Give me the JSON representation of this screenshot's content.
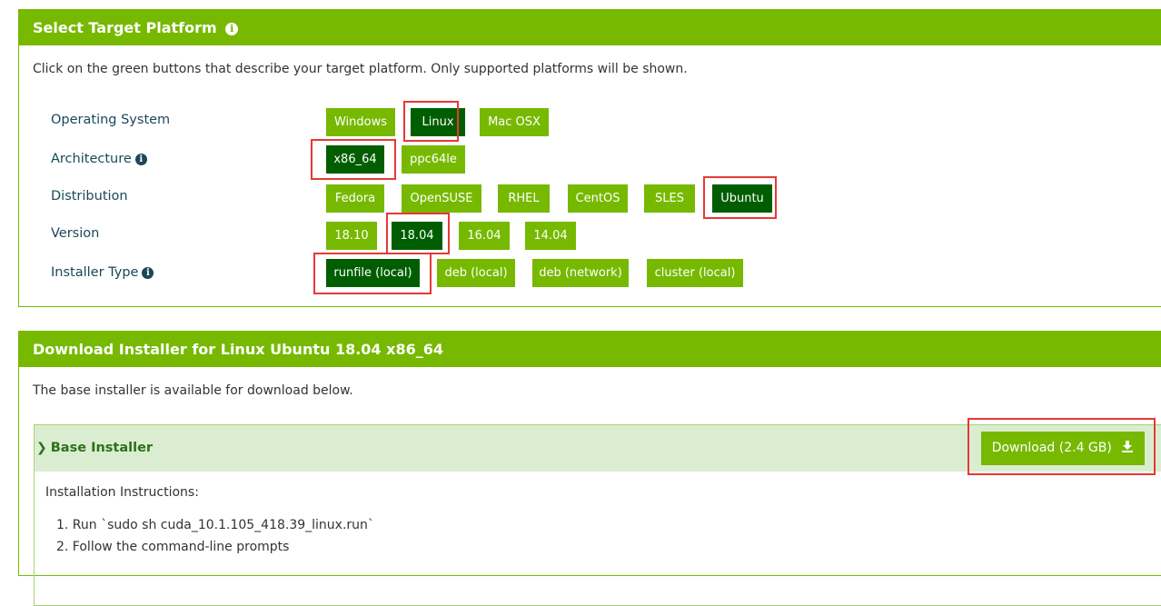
{
  "select_panel": {
    "title": "Select Target Platform",
    "info_icon": "info-circle-icon",
    "description": "Click on the green buttons that describe your target platform. Only supported platforms will be shown.",
    "rows": {
      "os": {
        "label": "Operating System",
        "options": [
          "Windows",
          "Linux",
          "Mac OSX"
        ],
        "selected": "Linux"
      },
      "arch": {
        "label": "Architecture",
        "options": [
          "x86_64",
          "ppc64le"
        ],
        "selected": "x86_64"
      },
      "distro": {
        "label": "Distribution",
        "options": [
          "Fedora",
          "OpenSUSE",
          "RHEL",
          "CentOS",
          "SLES",
          "Ubuntu"
        ],
        "selected": "Ubuntu"
      },
      "version": {
        "label": "Version",
        "options": [
          "18.10",
          "18.04",
          "16.04",
          "14.04"
        ],
        "selected": "18.04"
      },
      "installer": {
        "label": "Installer Type",
        "options": [
          "runfile (local)",
          "deb (local)",
          "deb (network)",
          "cluster (local)"
        ],
        "selected": "runfile (local)"
      }
    }
  },
  "download_panel": {
    "title": "Download Installer for Linux Ubuntu 18.04 x86_64",
    "description": "The base installer is available for download below.",
    "base_installer": {
      "title": "Base Installer",
      "download_label": "Download (2.4 GB)",
      "download_icon": "download-icon",
      "instructions_heading": "Installation Instructions:",
      "steps": [
        "1. Run `sudo sh cuda_10.1.105_418.39_linux.run`",
        "2. Follow the command-line prompts"
      ]
    }
  },
  "colors": {
    "accent": "#76b900",
    "selected": "#005e00",
    "highlight": "#e53935",
    "sub_header_bg": "#dbedd0",
    "label_text": "#1a4858"
  }
}
